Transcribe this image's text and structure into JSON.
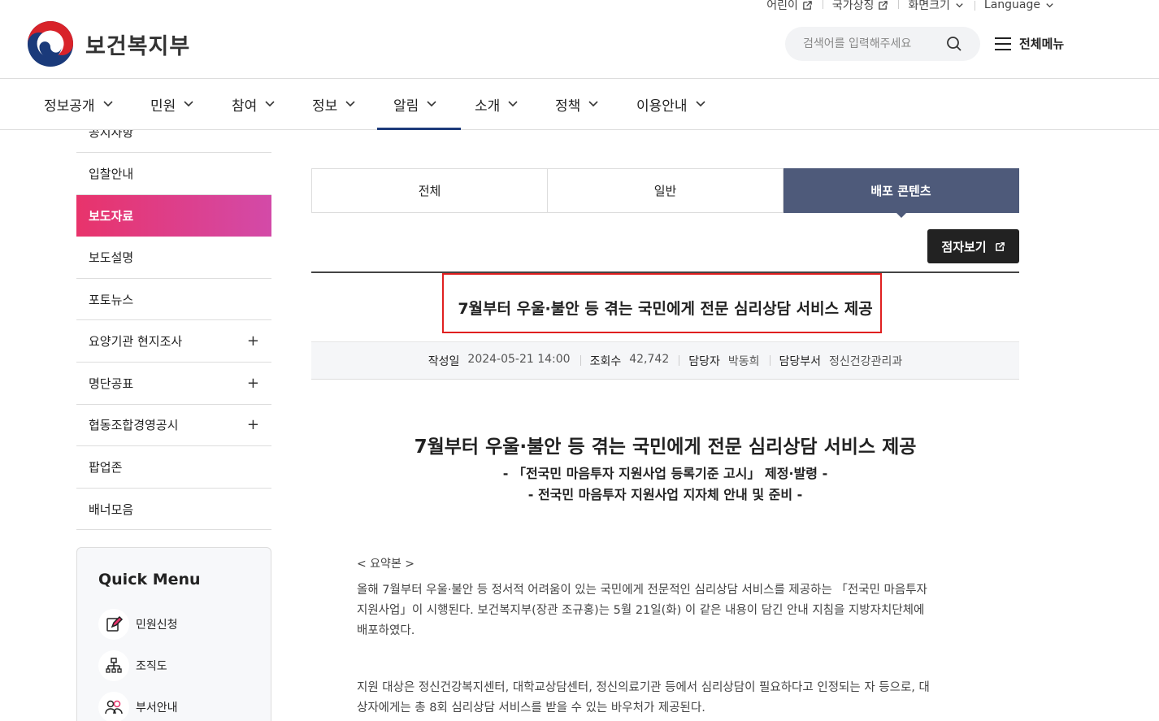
{
  "util": {
    "kids": "어린이",
    "symbol": "국가상징",
    "size": "화면크기",
    "language": "Language"
  },
  "brand": {
    "name": "보건복지부"
  },
  "search": {
    "placeholder": "검색어를 입력해주세요"
  },
  "allmenu": {
    "label": "전체메뉴"
  },
  "gnb": [
    "정보공개",
    "민원",
    "참여",
    "정보",
    "알림",
    "소개",
    "정책",
    "이용안내"
  ],
  "gnb_active": "알림",
  "lnb": {
    "partial_top": "공지사항",
    "items": [
      {
        "label": "입찰안내",
        "expand": ""
      },
      {
        "label": "보도자료",
        "expand": ""
      },
      {
        "label": "보도설명",
        "expand": ""
      },
      {
        "label": "포토뉴스",
        "expand": ""
      },
      {
        "label": "요양기관 현지조사",
        "expand": "+"
      },
      {
        "label": "명단공표",
        "expand": "+"
      },
      {
        "label": "협동조합경영공시",
        "expand": "+"
      },
      {
        "label": "팝업존",
        "expand": ""
      },
      {
        "label": "배너모음",
        "expand": ""
      }
    ],
    "active": "보도자료"
  },
  "quick": {
    "title": "Quick Menu",
    "items": [
      {
        "label": "민원신청",
        "icon": "pencil-icon"
      },
      {
        "label": "조직도",
        "icon": "org-chart-icon"
      },
      {
        "label": "부서안내",
        "icon": "people-icon"
      }
    ]
  },
  "tabs": [
    "전체",
    "일반",
    "배포 콘텐츠"
  ],
  "tab_active": "배포 콘텐츠",
  "braille": {
    "label": "점자보기"
  },
  "article": {
    "title": "7월부터 우울·불안 등 겪는 국민에게 전문 심리상담 서비스 제공",
    "meta": [
      {
        "key": "작성일",
        "value": "2024-05-21 14:00"
      },
      {
        "key": "조회수",
        "value": "42,742"
      },
      {
        "key": "담당자",
        "value": "박동희"
      },
      {
        "key": "담당부서",
        "value": "정신건강관리과"
      }
    ],
    "heading": "7월부터 우울·불안 등 겪는 국민에게 전문 심리상담 서비스 제공",
    "sub1": "- 「전국민 마음투자 지원사업 등록기준 고시」 제정·발령 -",
    "sub2": "- 전국민 마음투자 지원사업 지자체 안내 및 준비 -",
    "summary_label": "< 요약본 >",
    "para1": "올해 7월부터 우울·불안 등 정서적 어려움이 있는 국민에게 전문적인 심리상담 서비스를 제공하는 「전국민 마음투자 지원사업」이 시행된다. 보건복지부(장관 조규홍)는 5월 21일(화) 이 같은 내용이 담긴 안내 지침을 지방자치단체에 배포하였다.",
    "para2": "지원 대상은 정신건강복지센터, 대학교상담센터, 정신의료기관 등에서 심리상담이 필요하다고 인정되는 자 등으로, 대상자에게는 총 8회 심리상담 서비스를 받을 수 있는 바우처가 제공된다."
  },
  "colors": {
    "active_tab": "#4e5a7a",
    "lnb_active_from": "#e8336b",
    "lnb_active_to": "#d34aa8",
    "highlight_box": "#e02020",
    "gnb_underline": "#1d3a7a"
  }
}
